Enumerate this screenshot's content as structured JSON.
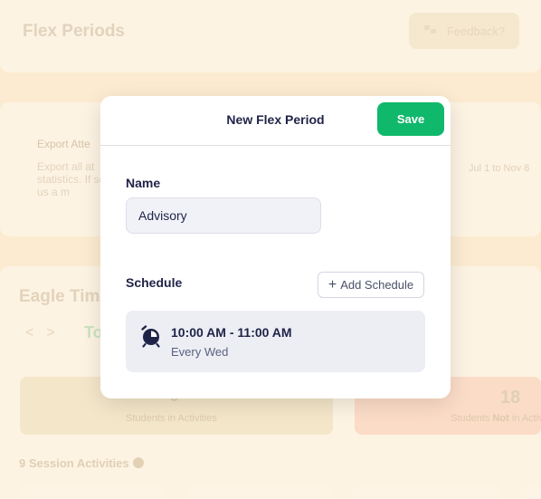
{
  "background": {
    "page_title": "Flex Periods",
    "feedback_label": "Feedback?",
    "export": {
      "title": "Export Atte",
      "description": "Export all at statistics. If send us a m",
      "date_range": "Jul 1 to Nov 8"
    },
    "sessions": {
      "title": "Eagle Tim",
      "nav_prev": "<",
      "nav_next": ">",
      "today_label": "To",
      "stats": [
        {
          "value": "0",
          "label_parts": [
            "Students in Activities"
          ]
        },
        {
          "value": "18",
          "label_before": "Students ",
          "label_bold": "Not",
          "label_after": " in Activ"
        }
      ],
      "session_activities": "9 Session Activities"
    }
  },
  "modal": {
    "title": "New Flex Period",
    "save_label": "Save",
    "name_label": "Name",
    "name_value": "Advisory",
    "schedule_label": "Schedule",
    "add_schedule_label": "Add Schedule",
    "schedules": [
      {
        "time": "10:00 AM - 11:00 AM",
        "recurrence": "Every Wed"
      }
    ]
  },
  "colors": {
    "accent_green": "#10b86c",
    "text_dark": "#1f2347",
    "overlay": "#fcebd0"
  }
}
